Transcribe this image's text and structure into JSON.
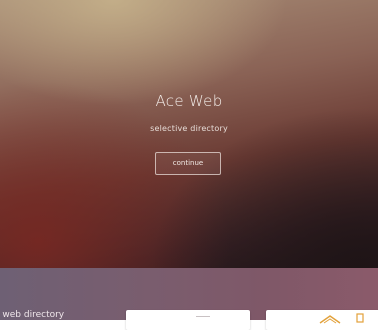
{
  "hero": {
    "title": "Ace Web",
    "subtitle": "selective directory",
    "button_label": "continue"
  },
  "band": {
    "text": "e web directory"
  },
  "cards": [
    {
      "name": "card-1"
    },
    {
      "name": "card-2",
      "logo_icon": "hexagon-logo-icon",
      "badge_icon": "bookmark-icon"
    }
  ],
  "colors": {
    "accent": "#e2a13a",
    "band": "#7a5d6e",
    "hero_dark": "#24171b"
  }
}
